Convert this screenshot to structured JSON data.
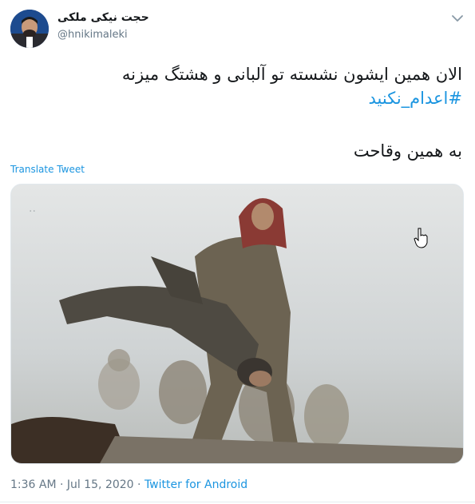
{
  "author": {
    "name": "حجت نیکی ملکی",
    "handle": "@hnikimaleki"
  },
  "tweet": {
    "text_line1": "الان همین ایشون نشسته تو آلبانی و هشتگ میزنه",
    "hashtag": "#اعدام_نکنید",
    "text_line2": "به همین وقاحت",
    "translate_label": "Translate Tweet"
  },
  "meta": {
    "timestamp": "1:36 AM · Jul 15, 2020 · ",
    "source": "Twitter for Android"
  },
  "icons": {
    "more": "chevron-down-icon",
    "cursor": "hand-cursor-icon"
  },
  "colors": {
    "link": "#1b95e0",
    "text": "#14171a",
    "secondary": "#657786"
  }
}
